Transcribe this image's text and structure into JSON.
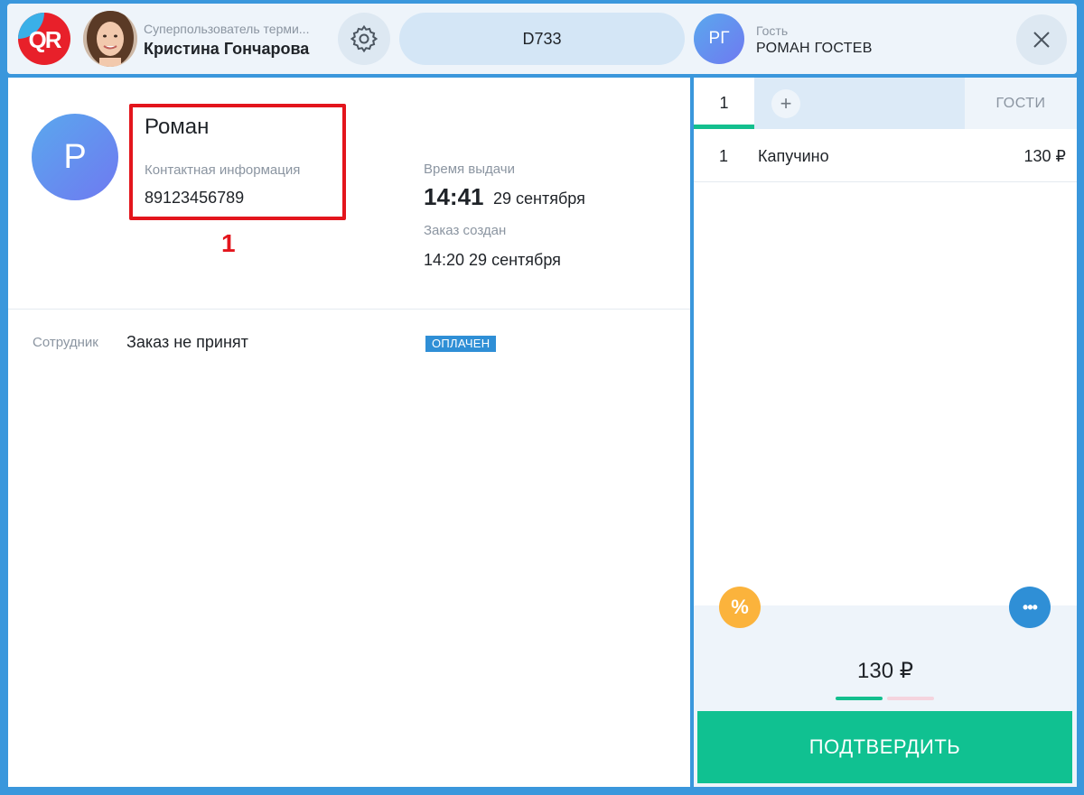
{
  "header": {
    "logo_text": "QR",
    "user_role": "Суперпользователь терми...",
    "user_name": "Кристина Гончарова",
    "order_number": "D733",
    "guest_initials": "РГ",
    "guest_label": "Гость",
    "guest_name": "РОМАН ГОСТЕВ",
    "icons": [
      "gear-icon",
      "close-icon"
    ]
  },
  "customer": {
    "initial": "Р",
    "name": "Роман",
    "contact_label": "Контактная информация",
    "phone": "89123456789",
    "marker": "1"
  },
  "timing": {
    "pickup_label": "Время выдачи",
    "pickup_time": "14:41",
    "pickup_date": "29 сентября",
    "created_label": "Заказ создан",
    "created_value": "14:20 29 сентября"
  },
  "employee": {
    "label": "Сотрудник",
    "value": "Заказ не принят",
    "status": "ОПЛАЧЕН"
  },
  "order_panel": {
    "tabs": {
      "active": "1",
      "add": "+",
      "guests": "ГОСТИ"
    },
    "items": [
      {
        "qty": "1",
        "name": "Капучино",
        "price": "130 ₽"
      }
    ],
    "discount_symbol": "%",
    "more_symbol": "•••",
    "total": "130 ₽",
    "confirm_label": "ПОДТВЕРДИТЬ"
  },
  "colors": {
    "accent_blue": "#2f8fd6",
    "confirm_green": "#10c191",
    "highlight_red": "#e3151c",
    "discount_orange": "#fbb33c"
  }
}
